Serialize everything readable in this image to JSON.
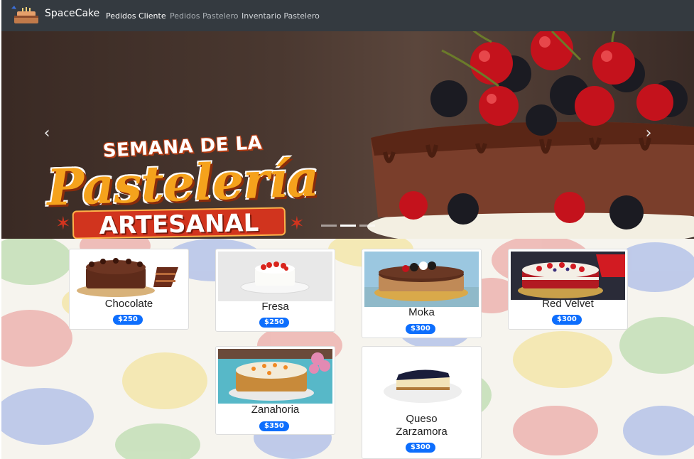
{
  "navbar": {
    "brand": "SpaceCake",
    "links": [
      "Pedidos Cliente",
      "Pedidos Pastelero",
      "Inventario Pastelero"
    ]
  },
  "carousel": {
    "line1": "SEMANA DE LA",
    "line2": "Pastelería",
    "line3": "ARTESANAL",
    "prev_label": "‹",
    "next_label": "›",
    "slide_count": 3,
    "active_slide": 1
  },
  "products": [
    {
      "name": "Chocolate",
      "price": "$250"
    },
    {
      "name": "Fresa",
      "price": "$250"
    },
    {
      "name": "Moka",
      "price": "$300"
    },
    {
      "name": "Red Velvet",
      "price": "$300"
    },
    {
      "name": "Zanahoria",
      "price": "$350"
    },
    {
      "name": "Queso",
      "name2": "Zarzamora",
      "price": "$300"
    }
  ],
  "image_text": {
    "red_velvet_badge": "RED Velvet"
  },
  "colors": {
    "navbar": "#343a40",
    "price_badge": "#0d6efd",
    "banner_orange": "#f5a21c",
    "banner_red": "#d1341e"
  }
}
